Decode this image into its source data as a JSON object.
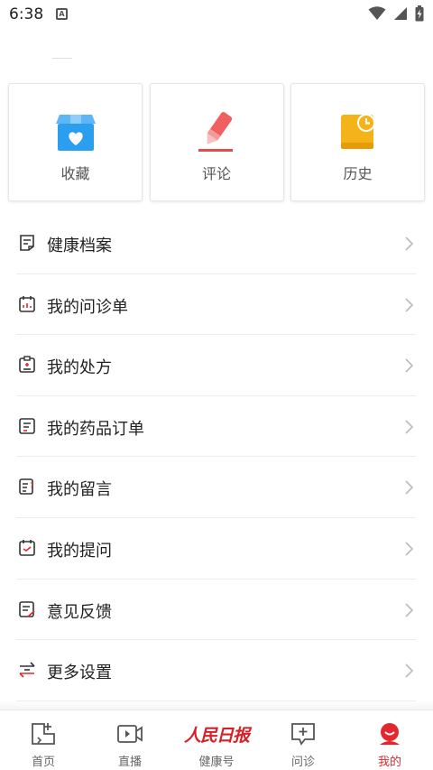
{
  "status_bar": {
    "time": "6:38",
    "notification_icon": "A"
  },
  "quick_cards": [
    {
      "label": "收藏",
      "icon": "favorites-box-icon",
      "color": "#2b9ef0"
    },
    {
      "label": "评论",
      "icon": "pen-icon",
      "color": "#f06060"
    },
    {
      "label": "历史",
      "icon": "history-book-icon",
      "color": "#f5b31a"
    }
  ],
  "menu": {
    "items": [
      {
        "label": "健康档案",
        "icon": "health-record-icon"
      },
      {
        "label": "我的问诊单",
        "icon": "consultation-icon"
      },
      {
        "label": "我的处方",
        "icon": "prescription-icon"
      },
      {
        "label": "我的药品订单",
        "icon": "medicine-order-icon"
      },
      {
        "label": "我的留言",
        "icon": "message-icon"
      },
      {
        "label": "我的提问",
        "icon": "question-icon"
      },
      {
        "label": "意见反馈",
        "icon": "feedback-icon"
      },
      {
        "label": "更多设置",
        "icon": "settings-icon"
      }
    ]
  },
  "bottom_nav": {
    "tabs": [
      {
        "label": "首页",
        "icon": "home-icon"
      },
      {
        "label": "直播",
        "icon": "live-video-icon"
      },
      {
        "label": "健康号",
        "logo": "人民日报"
      },
      {
        "label": "问诊",
        "icon": "consult-chat-icon"
      },
      {
        "label": "我的",
        "icon": "profile-icon"
      }
    ],
    "active_index": 4,
    "active_color": "#e4272e"
  }
}
